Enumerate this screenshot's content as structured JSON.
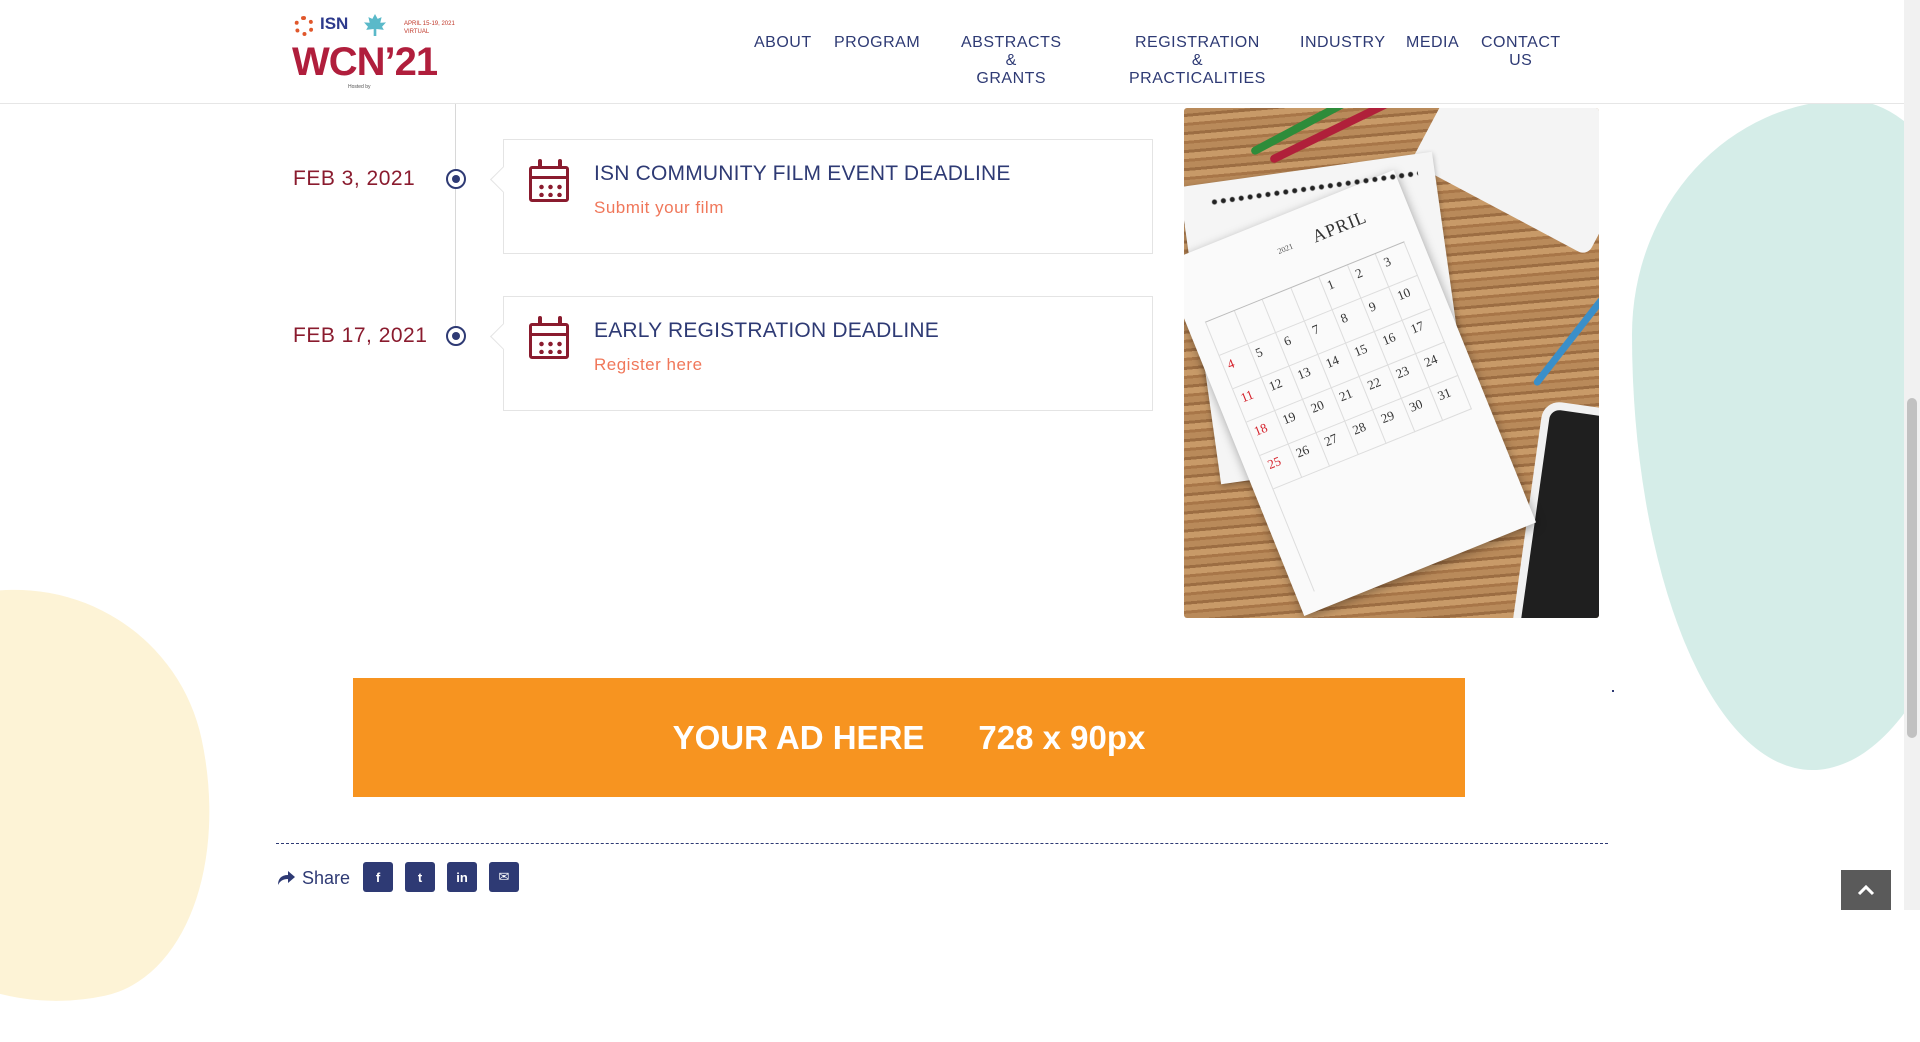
{
  "brand": {
    "logo_org": "ISN",
    "logo_event": "WCN",
    "logo_year": "’21",
    "logo_dates": "APRIL 15-19, 2021 VIRTUAL",
    "logo_hosted": "Hosted by"
  },
  "nav": [
    {
      "label": "ABOUT"
    },
    {
      "label": "PROGRAM"
    },
    {
      "label": "ABSTRACTS &\nGRANTS"
    },
    {
      "label": "REGISTRATION &\nPRACTICALITIES"
    },
    {
      "label": "INDUSTRY"
    },
    {
      "label": "MEDIA"
    },
    {
      "label": "CONTACT US"
    }
  ],
  "timeline": [
    {
      "date": "FEB 3, 2021",
      "title": "ISN COMMUNITY FILM EVENT DEADLINE",
      "link": "Submit your film"
    },
    {
      "date": "FEB 17, 2021",
      "title": "EARLY REGISTRATION DEADLINE",
      "link": "Register here"
    }
  ],
  "photo": {
    "month": "APRIL",
    "year": "2021",
    "days": [
      "",
      "",
      "",
      "",
      "1",
      "2",
      "3",
      "4",
      "5",
      "6",
      "7",
      "8",
      "9",
      "10",
      "11",
      "12",
      "13",
      "14",
      "15",
      "16",
      "17",
      "18",
      "19",
      "20",
      "21",
      "22",
      "23",
      "24",
      "25",
      "26",
      "27",
      "28",
      "29",
      "30",
      "31"
    ]
  },
  "ad": {
    "text": "YOUR AD HERE",
    "size": "728 x 90px",
    "color": "#f79420"
  },
  "share": {
    "label": "Share",
    "buttons": [
      {
        "icon": "facebook-icon",
        "glyph": "f"
      },
      {
        "icon": "twitter-icon",
        "glyph": "t"
      },
      {
        "icon": "linkedin-icon",
        "glyph": "in"
      },
      {
        "icon": "email-icon",
        "glyph": "✉"
      }
    ]
  },
  "colors": {
    "navy": "#2e3a74",
    "maroon": "#8a1b2e",
    "coral": "#f0775a"
  }
}
